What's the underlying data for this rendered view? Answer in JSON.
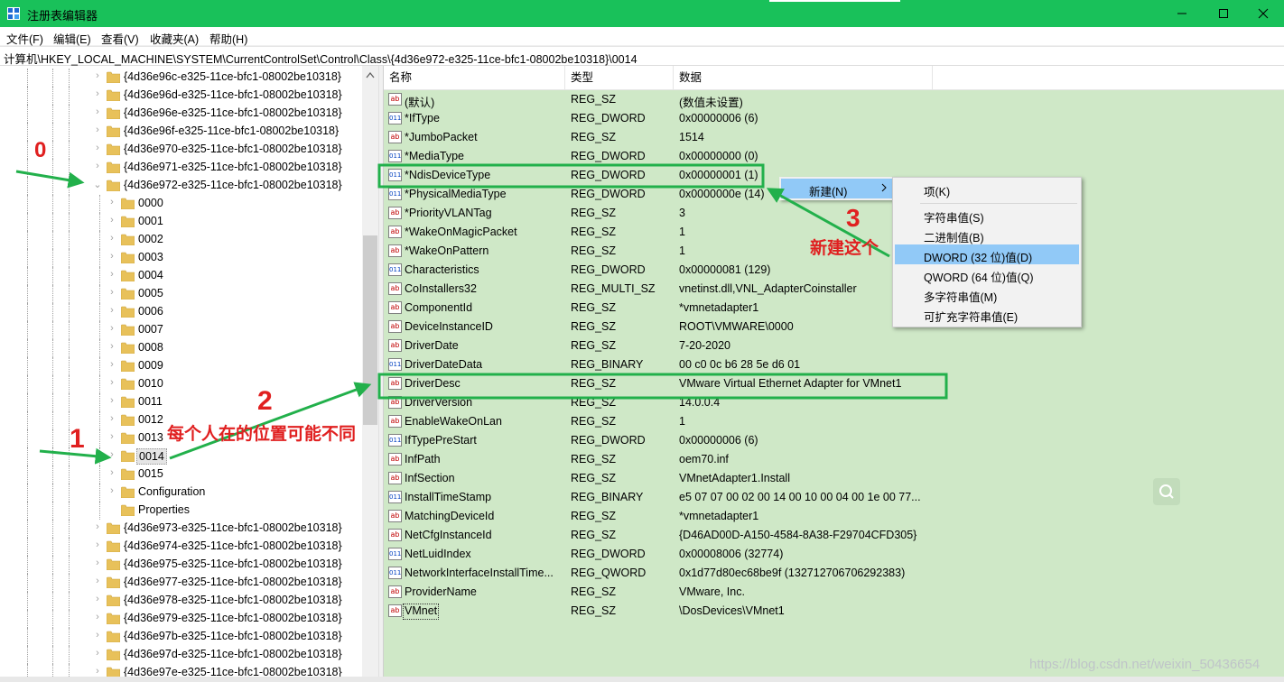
{
  "window": {
    "title": "注册表编辑器",
    "minimize_icon": "minimize-icon",
    "maximize_icon": "maximize-icon",
    "close_icon": "close-icon"
  },
  "menu": [
    "文件(F)",
    "编辑(E)",
    "查看(V)",
    "收藏夹(A)",
    "帮助(H)"
  ],
  "address": "计算机\\HKEY_LOCAL_MACHINE\\SYSTEM\\CurrentControlSet\\Control\\Class\\{4d36e972-e325-11ce-bfc1-08002be10318}\\0014",
  "tree": [
    {
      "label": "{4d36e96c-e325-11ce-bfc1-08002be10318}",
      "level": 1,
      "expanded": false
    },
    {
      "label": "{4d36e96d-e325-11ce-bfc1-08002be10318}",
      "level": 1,
      "expanded": false
    },
    {
      "label": "{4d36e96e-e325-11ce-bfc1-08002be10318}",
      "level": 1,
      "expanded": false
    },
    {
      "label": "{4d36e96f-e325-11ce-bfc1-08002be10318}",
      "level": 1,
      "expanded": false
    },
    {
      "label": "{4d36e970-e325-11ce-bfc1-08002be10318}",
      "level": 1,
      "expanded": false
    },
    {
      "label": "{4d36e971-e325-11ce-bfc1-08002be10318}",
      "level": 1,
      "expanded": false
    },
    {
      "label": "{4d36e972-e325-11ce-bfc1-08002be10318}",
      "level": 1,
      "expanded": true
    },
    {
      "label": "0000",
      "level": 2,
      "expanded": false
    },
    {
      "label": "0001",
      "level": 2,
      "expanded": false
    },
    {
      "label": "0002",
      "level": 2,
      "expanded": false
    },
    {
      "label": "0003",
      "level": 2,
      "expanded": false
    },
    {
      "label": "0004",
      "level": 2,
      "expanded": false
    },
    {
      "label": "0005",
      "level": 2,
      "expanded": false
    },
    {
      "label": "0006",
      "level": 2,
      "expanded": false
    },
    {
      "label": "0007",
      "level": 2,
      "expanded": false
    },
    {
      "label": "0008",
      "level": 2,
      "expanded": false
    },
    {
      "label": "0009",
      "level": 2,
      "expanded": false
    },
    {
      "label": "0010",
      "level": 2,
      "expanded": false
    },
    {
      "label": "0011",
      "level": 2,
      "expanded": false
    },
    {
      "label": "0012",
      "level": 2,
      "expanded": false
    },
    {
      "label": "0013",
      "level": 2,
      "expanded": false
    },
    {
      "label": "0014",
      "level": 2,
      "expanded": false,
      "selected": true
    },
    {
      "label": "0015",
      "level": 2,
      "expanded": false
    },
    {
      "label": "Configuration",
      "level": 2,
      "expanded": false
    },
    {
      "label": "Properties",
      "level": 2,
      "expanded": false,
      "leaf": true
    },
    {
      "label": "{4d36e973-e325-11ce-bfc1-08002be10318}",
      "level": 1,
      "expanded": false
    },
    {
      "label": "{4d36e974-e325-11ce-bfc1-08002be10318}",
      "level": 1,
      "expanded": false
    },
    {
      "label": "{4d36e975-e325-11ce-bfc1-08002be10318}",
      "level": 1,
      "expanded": false
    },
    {
      "label": "{4d36e977-e325-11ce-bfc1-08002be10318}",
      "level": 1,
      "expanded": false
    },
    {
      "label": "{4d36e978-e325-11ce-bfc1-08002be10318}",
      "level": 1,
      "expanded": false
    },
    {
      "label": "{4d36e979-e325-11ce-bfc1-08002be10318}",
      "level": 1,
      "expanded": false
    },
    {
      "label": "{4d36e97b-e325-11ce-bfc1-08002be10318}",
      "level": 1,
      "expanded": false
    },
    {
      "label": "{4d36e97d-e325-11ce-bfc1-08002be10318}",
      "level": 1,
      "expanded": false
    },
    {
      "label": "{4d36e97e-e325-11ce-bfc1-08002be10318}",
      "level": 1,
      "expanded": false
    }
  ],
  "columns": {
    "name": "名称",
    "type": "类型",
    "data": "数据"
  },
  "values": [
    {
      "name": "(默认)",
      "type": "REG_SZ",
      "data": "(数值未设置)",
      "icon": "ab"
    },
    {
      "name": "*IfType",
      "type": "REG_DWORD",
      "data": "0x00000006 (6)",
      "icon": "bin"
    },
    {
      "name": "*JumboPacket",
      "type": "REG_SZ",
      "data": "1514",
      "icon": "ab"
    },
    {
      "name": "*MediaType",
      "type": "REG_DWORD",
      "data": "0x00000000 (0)",
      "icon": "bin"
    },
    {
      "name": "*NdisDeviceType",
      "type": "REG_DWORD",
      "data": "0x00000001 (1)",
      "icon": "bin"
    },
    {
      "name": "*PhysicalMediaType",
      "type": "REG_DWORD",
      "data": "0x0000000e (14)",
      "icon": "bin"
    },
    {
      "name": "*PriorityVLANTag",
      "type": "REG_SZ",
      "data": "3",
      "icon": "ab"
    },
    {
      "name": "*WakeOnMagicPacket",
      "type": "REG_SZ",
      "data": "1",
      "icon": "ab"
    },
    {
      "name": "*WakeOnPattern",
      "type": "REG_SZ",
      "data": "1",
      "icon": "ab"
    },
    {
      "name": "Characteristics",
      "type": "REG_DWORD",
      "data": "0x00000081 (129)",
      "icon": "bin"
    },
    {
      "name": "CoInstallers32",
      "type": "REG_MULTI_SZ",
      "data": "vnetinst.dll,VNL_AdapterCoinstaller",
      "icon": "ab"
    },
    {
      "name": "ComponentId",
      "type": "REG_SZ",
      "data": "*vmnetadapter1",
      "icon": "ab"
    },
    {
      "name": "DeviceInstanceID",
      "type": "REG_SZ",
      "data": "ROOT\\VMWARE\\0000",
      "icon": "ab"
    },
    {
      "name": "DriverDate",
      "type": "REG_SZ",
      "data": "7-20-2020",
      "icon": "ab"
    },
    {
      "name": "DriverDateData",
      "type": "REG_BINARY",
      "data": "00 c0 0c b6 28 5e d6 01",
      "icon": "bin"
    },
    {
      "name": "DriverDesc",
      "type": "REG_SZ",
      "data": "VMware Virtual Ethernet Adapter for VMnet1",
      "icon": "ab"
    },
    {
      "name": "DriverVersion",
      "type": "REG_SZ",
      "data": "14.0.0.4",
      "icon": "ab"
    },
    {
      "name": "EnableWakeOnLan",
      "type": "REG_SZ",
      "data": "1",
      "icon": "ab"
    },
    {
      "name": "IfTypePreStart",
      "type": "REG_DWORD",
      "data": "0x00000006 (6)",
      "icon": "bin"
    },
    {
      "name": "InfPath",
      "type": "REG_SZ",
      "data": "oem70.inf",
      "icon": "ab"
    },
    {
      "name": "InfSection",
      "type": "REG_SZ",
      "data": "VMnetAdapter1.Install",
      "icon": "ab"
    },
    {
      "name": "InstallTimeStamp",
      "type": "REG_BINARY",
      "data": "e5 07 07 00 02 00 14 00 10 00 04 00 1e 00 77...",
      "icon": "bin"
    },
    {
      "name": "MatchingDeviceId",
      "type": "REG_SZ",
      "data": "*vmnetadapter1",
      "icon": "ab"
    },
    {
      "name": "NetCfgInstanceId",
      "type": "REG_SZ",
      "data": "{D46AD00D-A150-4584-8A38-F29704CFD305}",
      "icon": "ab"
    },
    {
      "name": "NetLuidIndex",
      "type": "REG_DWORD",
      "data": "0x00008006 (32774)",
      "icon": "bin"
    },
    {
      "name": "NetworkInterfaceInstallTime...",
      "type": "REG_QWORD",
      "data": "0x1d77d80ec68be9f (132712706706292383)",
      "icon": "bin"
    },
    {
      "name": "ProviderName",
      "type": "REG_SZ",
      "data": "VMware, Inc.",
      "icon": "ab"
    },
    {
      "name": "VMnet",
      "type": "REG_SZ",
      "data": "\\DosDevices\\VMnet1",
      "icon": "ab",
      "focus": true
    }
  ],
  "context_menu": {
    "new_label": "新建(N)",
    "submenu": [
      "项(K)",
      "字符串值(S)",
      "二进制值(B)",
      "DWORD (32 位)值(D)",
      "QWORD (64 位)值(Q)",
      "多字符串值(M)",
      "可扩充字符串值(E)"
    ],
    "highlighted": "DWORD (32 位)值(D)"
  },
  "annotations": {
    "n0": "0",
    "n1": "1",
    "n2": "2",
    "n3": "3",
    "note2": "每个人在的位置可能不同",
    "note3": "新建这个"
  },
  "watermark": "https://blog.csdn.net/weixin_50436654",
  "colors": {
    "titlebar": "#19c15a",
    "list_bg": "#cfe8c7",
    "highlight": "#91c9f7",
    "annotation_green": "#22b04b",
    "annotation_red": "#e02020"
  }
}
